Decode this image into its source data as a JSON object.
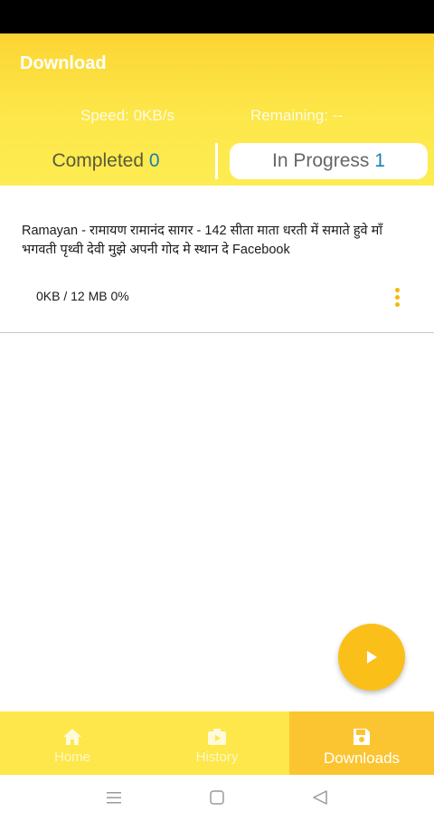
{
  "header": {
    "title": "Download",
    "speed": "Speed: 0KB/s",
    "remaining": "Remaining: --"
  },
  "tabs": {
    "completed": {
      "label": "Completed",
      "count": "0"
    },
    "in_progress": {
      "label": "In Progress",
      "count": "1"
    }
  },
  "downloads": [
    {
      "title": "Ramayan - रामायण रामानंद सागर - 142 सीता माता धरती में समाते हुवे माँ भगवती पृथ्वी देवी मुझे अपनी गोद मे स्थान दे  Facebook",
      "progress": "0KB / 12 MB 0%"
    }
  ],
  "fab": {
    "icon": "play-icon"
  },
  "bottom_nav": {
    "home": {
      "label": "Home",
      "icon": "home-icon"
    },
    "history": {
      "label": "History",
      "icon": "history-icon"
    },
    "downloads": {
      "label": "Downloads",
      "icon": "save-icon"
    }
  },
  "colors": {
    "accent_yellow": "#fde74a",
    "fab_yellow": "#fbbf1a",
    "active_tab": "#fbc531",
    "count_blue": "#1a7fb0"
  }
}
